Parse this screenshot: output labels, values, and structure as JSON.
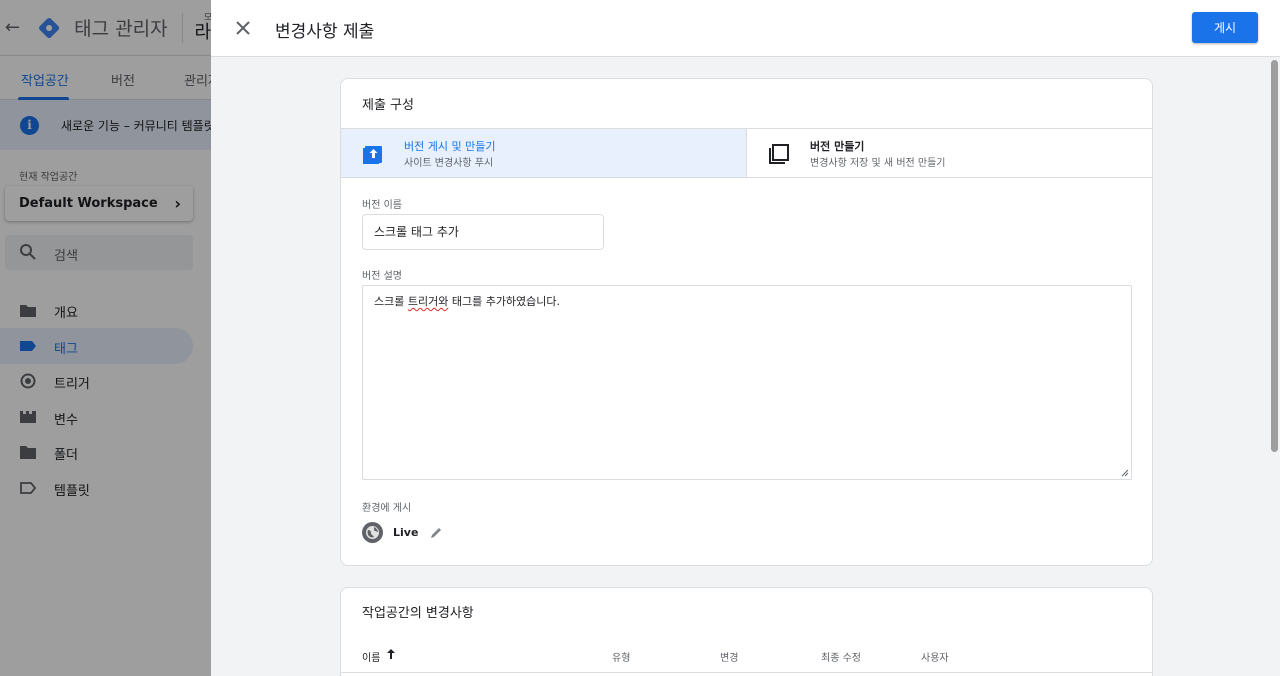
{
  "app": {
    "title": "태그 관리자",
    "header_fragment": "라",
    "header_fragment_small": "모",
    "tabs": [
      "작업공간",
      "버전",
      "관리자"
    ],
    "banner_text": "새로운 기능 – 커뮤니티 템플릿 갤",
    "workspace_label": "현재 작업공간",
    "workspace_name": "Default Workspace",
    "search_placeholder": "검색",
    "nav": [
      {
        "label": "개요",
        "icon": "folder-open-icon"
      },
      {
        "label": "태그",
        "icon": "tag-icon"
      },
      {
        "label": "트리거",
        "icon": "trigger-icon"
      },
      {
        "label": "변수",
        "icon": "variables-icon"
      },
      {
        "label": "폴더",
        "icon": "folder-icon"
      },
      {
        "label": "템플릿",
        "icon": "template-tag-icon"
      }
    ]
  },
  "sheet": {
    "title": "변경사항 제출",
    "publish_label": "게시",
    "config_title": "제출 구성",
    "options": [
      {
        "title": "버전 게시 및 만들기",
        "subtitle": "사이트 변경사항 푸시"
      },
      {
        "title": "버전 만들기",
        "subtitle": "변경사항 저장 및 새 버전 만들기"
      }
    ],
    "version_name_label": "버전 이름",
    "version_name_value": "스크롤 태그 추가",
    "version_desc_label": "버전 설명",
    "version_desc_before": "스크롤 ",
    "version_desc_misspelled": "트리거와",
    "version_desc_after": " 태그를 추가하였습니다.",
    "env_label": "환경에 게시",
    "env_name": "Live",
    "changes_title": "작업공간의 변경사항",
    "columns": [
      "이름",
      "유형",
      "변경",
      "최종 수정",
      "사용자"
    ]
  },
  "colors": {
    "accent": "#1a73e8",
    "selected_bg": "#e8f0fe",
    "border": "#dadce0"
  }
}
